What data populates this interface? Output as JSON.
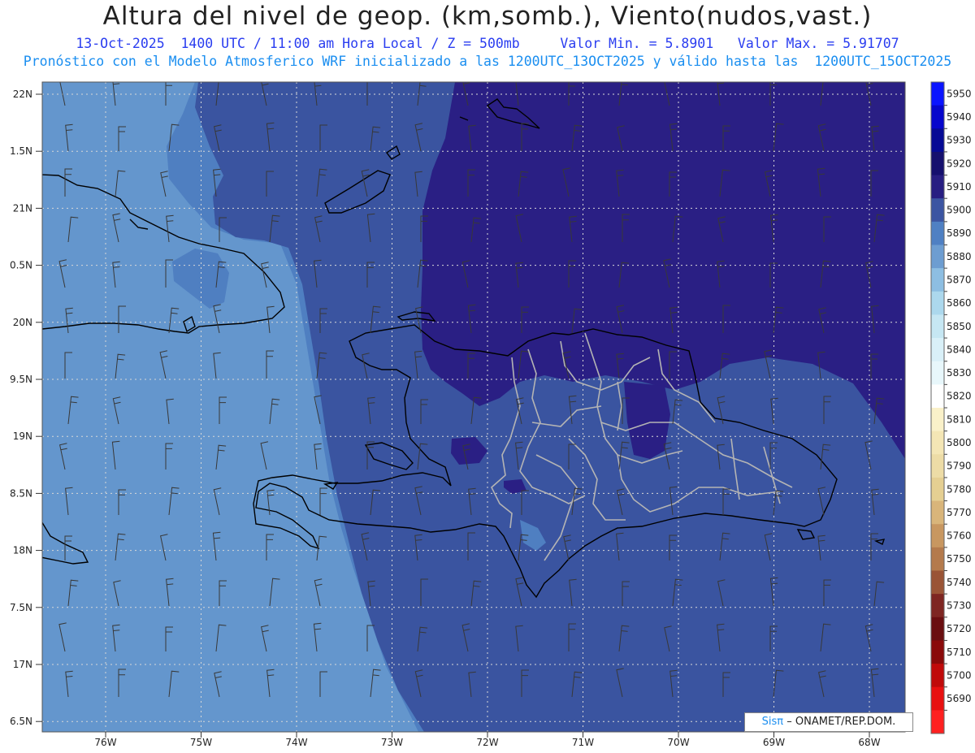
{
  "header": {
    "title": "Altura del nivel de geop. (km,somb.), Viento(nudos,vast.)",
    "line2": "13-Oct-2025  1400 UTC / 11:00 am Hora Local / Z = 500mb     Valor Min. = 5.8901   Valor Max. = 5.91707",
    "line3": "Pronóstico con el Modelo Atmosferico WRF inicializado a las 1200UTC_13OCT2025 y válido hasta las  1200UTC_15OCT2025"
  },
  "map": {
    "lat_labels": [
      "22N",
      "1.5N",
      "21N",
      "0.5N",
      "20N",
      "9.5N",
      "19N",
      "8.5N",
      "18N",
      "7.5N",
      "17N",
      "6.5N"
    ],
    "lon_labels": [
      "76W",
      "75W",
      "74W",
      "73W",
      "72W",
      "71W",
      "70W",
      "69W",
      "68W"
    ],
    "colors": {
      "level_5880": "#6496cd",
      "level_5890": "#4f7fc1",
      "level_5900": "#3a54a0",
      "level_5910": "#2a1f84",
      "coast": "#000000",
      "provinces": "#b4b4b4"
    }
  },
  "colorbar": {
    "levels": [
      "5950",
      "5940",
      "5930",
      "5920",
      "5910",
      "5900",
      "5890",
      "5880",
      "5870",
      "5860",
      "5850",
      "5840",
      "5830",
      "5820",
      "5810",
      "5800",
      "5790",
      "5780",
      "5770",
      "5760",
      "5750",
      "5740",
      "5730",
      "5720",
      "5710",
      "5700",
      "5690"
    ],
    "colors": [
      "#0a14ff",
      "#0606cc",
      "#060a95",
      "#16106e",
      "#281e82",
      "#3c55a2",
      "#4f80c3",
      "#6d9dd1",
      "#8dbee2",
      "#acd8ed",
      "#c6e7f3",
      "#d9f0f8",
      "#e8f7fb",
      "#ffffff",
      "#faf1c9",
      "#f4e6b5",
      "#eddca6",
      "#e5cf92",
      "#d9b57a",
      "#c89760",
      "#b47a4c",
      "#9a5436",
      "#7e2622",
      "#6a0e10",
      "#8a0a0a",
      "#c00a0a",
      "#e81010",
      "#ff2020"
    ]
  },
  "credit": {
    "sis": "Sisπ",
    "text": "– ONAMET/REP.DOM."
  }
}
